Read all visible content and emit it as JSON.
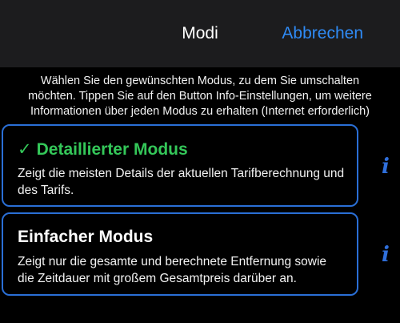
{
  "navbar": {
    "title": "Modi",
    "cancel_label": "Abbrechen"
  },
  "intro_text": "Wählen Sie den gewünschten Modus, zu dem Sie umschalten möchten. Tippen Sie auf den Button Info-Einstellungen, um weitere Informationen über jeden Modus zu erhalten (Internet erforderlich)",
  "modes": [
    {
      "check_icon": "✓",
      "title": "Detaillierter Modus",
      "description": "Zeigt die meisten Details der aktuellen Tarifberechnung und des Tarifs.",
      "selected": true,
      "info_icon": "i"
    },
    {
      "title": "Einfacher Modus",
      "description": "Zeigt nur die gesamte und berechnete Entfernung sowie die Zeitdauer mit großem Gesamtpreis darüber an.",
      "selected": false,
      "info_icon": "i"
    }
  ],
  "colors": {
    "accent_blue": "#2f8bf6",
    "selected_green": "#34c759",
    "card_border": "#2a6fd6",
    "navbar_bg": "#1c1c1e"
  }
}
